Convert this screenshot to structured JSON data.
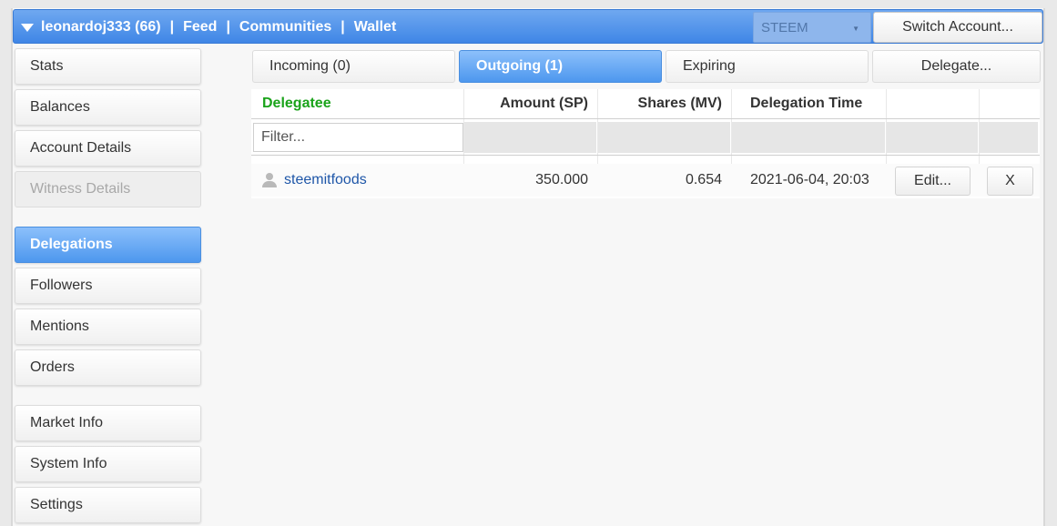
{
  "topbar": {
    "account": "leonardoj333 (66)",
    "links": [
      "Feed",
      "Communities",
      "Wallet"
    ],
    "separator": "|",
    "chain": "STEEM",
    "switch_label": "Switch Account..."
  },
  "sidebar": {
    "items": [
      {
        "label": "Stats"
      },
      {
        "label": "Balances"
      },
      {
        "label": "Account Details"
      },
      {
        "label": "Witness Details"
      },
      {
        "label": "Delegations"
      },
      {
        "label": "Followers"
      },
      {
        "label": "Mentions"
      },
      {
        "label": "Orders"
      },
      {
        "label": "Market Info"
      },
      {
        "label": "System Info"
      },
      {
        "label": "Settings"
      }
    ]
  },
  "tabs": {
    "incoming": "Incoming (0)",
    "outgoing": "Outgoing (1)",
    "expiring": "Expiring",
    "delegate": "Delegate..."
  },
  "table": {
    "headers": {
      "delegatee": "Delegatee",
      "amount": "Amount (SP)",
      "shares": "Shares (MV)",
      "time": "Delegation Time"
    },
    "filter_placeholder": "Filter...",
    "rows": [
      {
        "delegatee": "steemitfoods",
        "amount": "350.000",
        "shares": "0.654",
        "time": "2021-06-04, 20:03",
        "edit_label": "Edit...",
        "remove_label": "X"
      }
    ]
  },
  "colors": {
    "accent": "#4d97ee",
    "header_green": "#1aa31a",
    "link": "#1e56a8"
  }
}
